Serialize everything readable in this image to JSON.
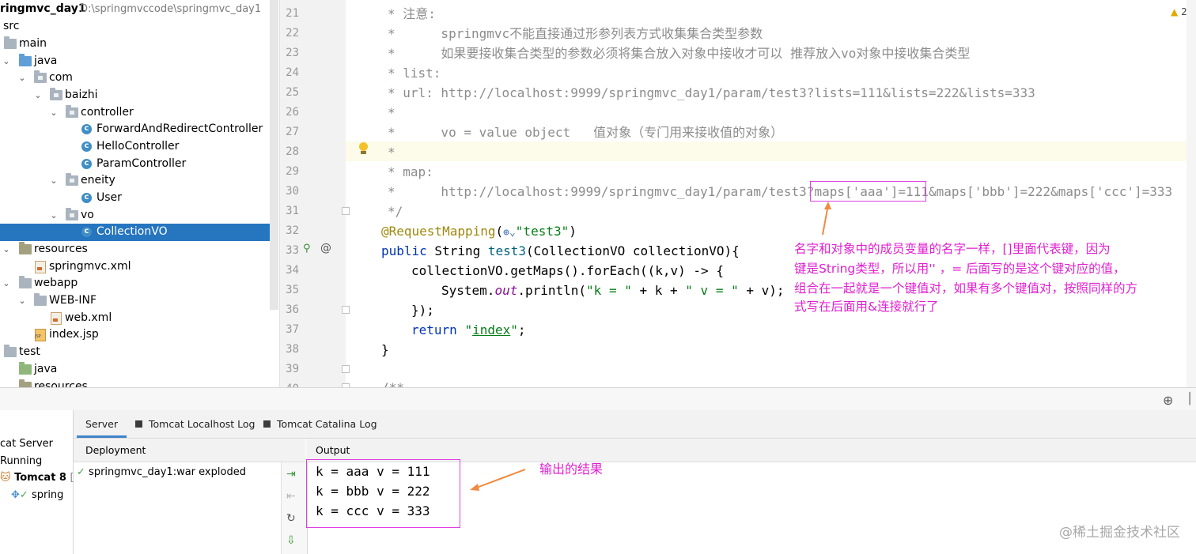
{
  "project_tree": {
    "root": {
      "name": "ringmvc_day1",
      "path": "D:\\springmvccode\\springmvc_day1"
    },
    "items": [
      {
        "label": "src",
        "kind": "none"
      },
      {
        "label": "main",
        "kind": "folder"
      },
      {
        "label": "java",
        "kind": "folder-source"
      },
      {
        "label": "com",
        "kind": "package"
      },
      {
        "label": "baizhi",
        "kind": "package"
      },
      {
        "label": "controller",
        "kind": "package"
      },
      {
        "label": "ForwardAndRedirectController",
        "kind": "class"
      },
      {
        "label": "HelloController",
        "kind": "class"
      },
      {
        "label": "ParamController",
        "kind": "class"
      },
      {
        "label": "eneity",
        "kind": "package"
      },
      {
        "label": "User",
        "kind": "class"
      },
      {
        "label": "vo",
        "kind": "package"
      },
      {
        "label": "CollectionVO",
        "kind": "class",
        "selected": true
      },
      {
        "label": "resources",
        "kind": "folder-resources"
      },
      {
        "label": "springmvc.xml",
        "kind": "xml"
      },
      {
        "label": "webapp",
        "kind": "folder"
      },
      {
        "label": "WEB-INF",
        "kind": "folder"
      },
      {
        "label": "web.xml",
        "kind": "xml"
      },
      {
        "label": "index.jsp",
        "kind": "jsp"
      },
      {
        "label": "test",
        "kind": "folder"
      },
      {
        "label": "java",
        "kind": "folder-test"
      },
      {
        "label": "resources",
        "kind": "folder-resources"
      }
    ]
  },
  "editor": {
    "warnings": "2",
    "line_numbers": [
      "21",
      "22",
      "23",
      "24",
      "25",
      "26",
      "27",
      "28",
      "29",
      "30",
      "31",
      "32",
      "33",
      "34",
      "35",
      "36",
      "37",
      "38",
      "39",
      "40"
    ],
    "lines": {
      "l21": "* 注意:",
      "l22": "*      springmvc不能直接通过形参列表方式收集集合类型参数",
      "l23": "*      如果要接收集合类型的参数必须将集合放入对象中接收才可以 推荐放入vo对象中接收集合类型",
      "l24": "* list:",
      "l25": "* url: http://localhost:9999/springmvc_day1/param/test3?lists=111&lists=222&lists=333",
      "l26": "*",
      "l27": "*      vo = value object   值对象（专门用来接收值的对象）",
      "l28": "*",
      "l29": "* map:",
      "l30a": "*      http://localhost:9999/springmvc_day1/param/test3?",
      "l30b": "maps['aaa']=111",
      "l30c": "&maps['bbb']=222&maps['ccc']=333",
      "l31": "*/",
      "l32_ann": "@RequestMapping",
      "l32_open": "(",
      "l32_str": "\"test3\"",
      "l32_close": ")",
      "l33_kw": "public",
      "l33_type": " String ",
      "l33_fn": "test3",
      "l33_rest": "(CollectionVO collectionVO){",
      "l34": "collectionVO.getMaps().forEach((k,v) -> {",
      "l35_a": "System.",
      "l35_out": "out",
      "l35_b": ".println(",
      "l35_s1": "\"k = \"",
      "l35_c": " + k + ",
      "l35_s2": "\" v = \"",
      "l35_d": " + v);",
      "l36": "});",
      "l37_kw": "return",
      "l37_q1": "\"",
      "l37_str": "index",
      "l37_q2": "\"",
      "l37_end": ";",
      "l38": "}",
      "l40": "/**"
    }
  },
  "annotations": {
    "code_note": [
      "名字和对象中的成员变量的名字一样，[]里面代表键，因为",
      "键是String类型，所以用'' ，= 后面写的是这个键对应的值，",
      "组合在一起就是一个键值对，如果有多个键值对，按照同样的方",
      "式写在后面用&连接就行了"
    ],
    "output_note": "输出的结果"
  },
  "bottom_panel": {
    "tabs": [
      "Server",
      "Tomcat Localhost Log",
      "Tomcat Catalina Log"
    ],
    "deployment_header": "Deployment",
    "output_header": "Output",
    "deployment_item": "springmvc_day1:war exploded",
    "servers": {
      "group": "cat Server",
      "status": "Running",
      "tomcat": "Tomcat 8",
      "tomcat_suffix": "[lo",
      "artifact": "spring"
    },
    "output_lines": [
      "k = aaa v = 111",
      "k = bbb v = 222",
      "k = ccc v = 333"
    ]
  },
  "watermark": "@稀土掘金技术社区",
  "colors": {
    "selection": "#2675bf",
    "annotation": "#e020d0",
    "keyword": "#0033b3",
    "string": "#067d17"
  }
}
